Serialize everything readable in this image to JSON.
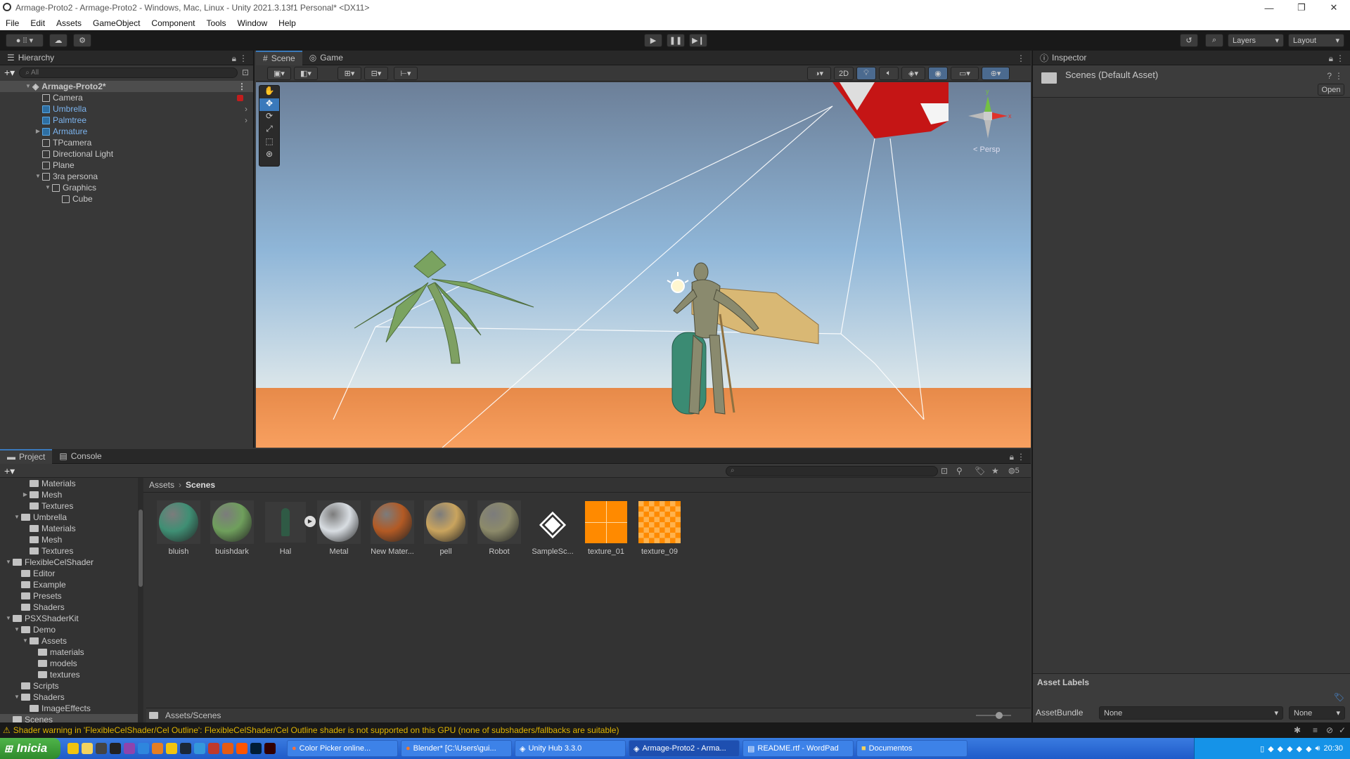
{
  "window": {
    "title": "Armage-Proto2 - Armage-Proto2 - Windows, Mac, Linux - Unity 2021.3.13f1 Personal* <DX11>"
  },
  "menu": [
    "File",
    "Edit",
    "Assets",
    "GameObject",
    "Component",
    "Tools",
    "Window",
    "Help"
  ],
  "toolbar": {
    "layers": "Layers",
    "layout": "Layout"
  },
  "hierarchy": {
    "title": "Hierarchy",
    "search_placeholder": "All",
    "items": [
      {
        "label": "Armage-Proto2*",
        "depth": 0,
        "kind": "scene"
      },
      {
        "label": "Camera",
        "depth": 1,
        "kind": "obj"
      },
      {
        "label": "Umbrella",
        "depth": 1,
        "kind": "prefab"
      },
      {
        "label": "Palmtree",
        "depth": 1,
        "kind": "prefab"
      },
      {
        "label": "Armature",
        "depth": 1,
        "kind": "prefab"
      },
      {
        "label": "TPcamera",
        "depth": 1,
        "kind": "obj"
      },
      {
        "label": "Directional Light",
        "depth": 1,
        "kind": "obj"
      },
      {
        "label": "Plane",
        "depth": 1,
        "kind": "obj"
      },
      {
        "label": "3ra persona",
        "depth": 1,
        "kind": "obj"
      },
      {
        "label": "Graphics",
        "depth": 2,
        "kind": "obj"
      },
      {
        "label": "Cube",
        "depth": 3,
        "kind": "obj"
      }
    ]
  },
  "scene": {
    "tab_scene": "Scene",
    "tab_game": "Game",
    "persp": "< Persp",
    "btn_2d": "2D"
  },
  "inspector": {
    "title": "Inspector",
    "asset": "Scenes (Default Asset)",
    "open": "Open",
    "asset_labels": "Asset Labels",
    "assetbundle": "AssetBundle",
    "ab_value": "None",
    "ab_variant": "None"
  },
  "project": {
    "tab_project": "Project",
    "tab_console": "Console",
    "breadcrumb": [
      "Assets",
      "Scenes"
    ],
    "footer_path": "Assets/Scenes",
    "hidden_count": "5",
    "folders": [
      {
        "label": "Materials",
        "depth": 3
      },
      {
        "label": "Mesh",
        "depth": 3
      },
      {
        "label": "Textures",
        "depth": 3
      },
      {
        "label": "Umbrella",
        "depth": 2
      },
      {
        "label": "Materials",
        "depth": 3
      },
      {
        "label": "Mesh",
        "depth": 3
      },
      {
        "label": "Textures",
        "depth": 3
      },
      {
        "label": "FlexibleCelShader",
        "depth": 1
      },
      {
        "label": "Editor",
        "depth": 2
      },
      {
        "label": "Example",
        "depth": 2
      },
      {
        "label": "Presets",
        "depth": 2
      },
      {
        "label": "Shaders",
        "depth": 2
      },
      {
        "label": "PSXShaderKit",
        "depth": 1
      },
      {
        "label": "Demo",
        "depth": 2
      },
      {
        "label": "Assets",
        "depth": 3
      },
      {
        "label": "materials",
        "depth": 4
      },
      {
        "label": "models",
        "depth": 4
      },
      {
        "label": "textures",
        "depth": 4
      },
      {
        "label": "Scripts",
        "depth": 2
      },
      {
        "label": "Shaders",
        "depth": 2
      },
      {
        "label": "ImageEffects",
        "depth": 3
      },
      {
        "label": "Scenes",
        "depth": 1
      }
    ],
    "assets": [
      {
        "label": "bluish",
        "color": "#3f8f74"
      },
      {
        "label": "buishdark",
        "color": "#6f9f5c"
      },
      {
        "label": "Hal",
        "color": "#2f5a45"
      },
      {
        "label": "Metal",
        "color": "#d8dde2"
      },
      {
        "label": "New Mater...",
        "color": "#b35a24"
      },
      {
        "label": "pell",
        "color": "#c9a45e"
      },
      {
        "label": "Robot",
        "color": "#8c8a6a"
      },
      {
        "label": "SampleSc...",
        "color": "#ffffff"
      },
      {
        "label": "texture_01",
        "color": "#ff8a00"
      },
      {
        "label": "texture_09",
        "color": "#ff8a00"
      }
    ]
  },
  "status": {
    "message": "Shader warning in 'FlexibleCelShader/Cel Outline': FlexibleCelShader/Cel Outline shader is not supported on this GPU (none of subshaders/fallbacks are suitable)"
  },
  "taskbar": {
    "start": "Inicia",
    "items": [
      "Color Picker online...",
      "Blender* [C:\\Users\\gui...",
      "Unity Hub 3.3.0",
      "Armage-Proto2 - Arma...",
      "README.rtf - WordPad",
      "Documentos"
    ],
    "clock": "20:30"
  },
  "colors": {
    "accent": "#3a79bb",
    "prefab_text": "#7cb4ef",
    "warning": "#e0b400"
  }
}
